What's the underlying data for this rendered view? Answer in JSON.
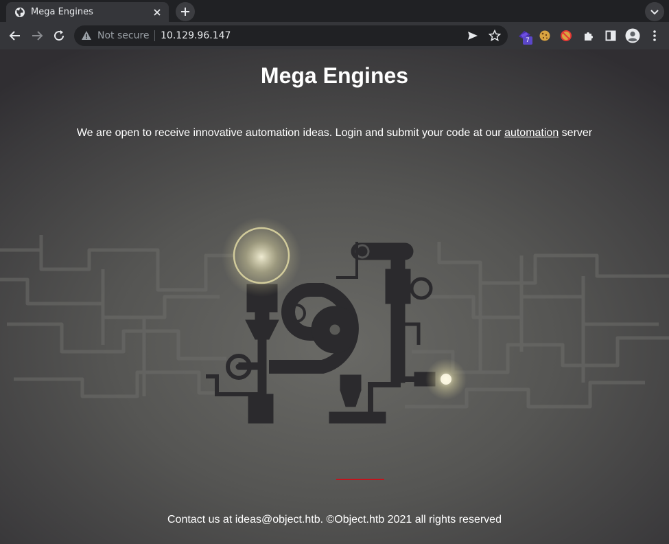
{
  "browser": {
    "tab": {
      "title": "Mega Engines"
    },
    "omnibox": {
      "security_label": "Not secure",
      "url": "10.129.96.147"
    },
    "extensions": {
      "badge_count": "7"
    }
  },
  "page": {
    "title": "Mega Engines",
    "intro": {
      "before_link": "We are open to receive innovative automation ideas. Login and submit your code at our ",
      "link_text": "automation",
      "after_link": " server"
    },
    "footer": {
      "before_link": "Contact us at ideas@object.htb. ©",
      "brand": "Object.htb",
      "after_link": " 2021 all rights reserved"
    }
  },
  "colors": {
    "chrome_bg": "#202124",
    "toolbar_bg": "#35363a",
    "footer_underline": "#c1141c"
  }
}
